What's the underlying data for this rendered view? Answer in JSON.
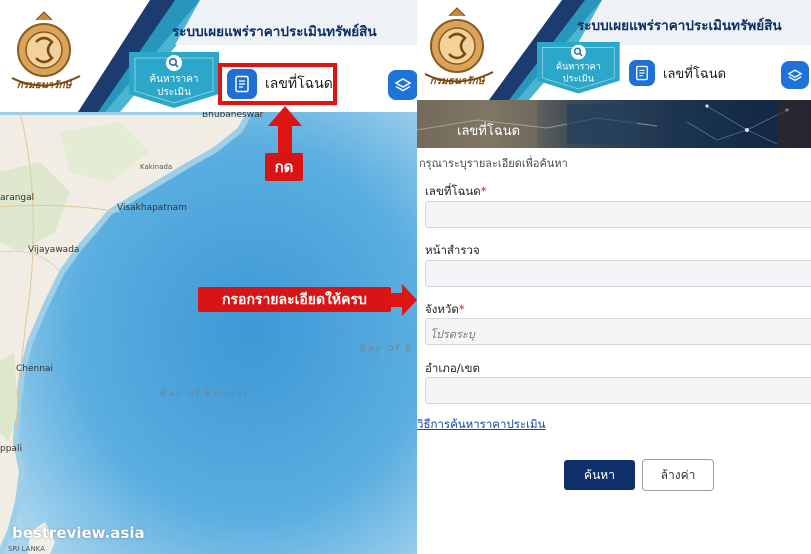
{
  "site": {
    "title": "ระบบเผยแพร่ราคาประเมินทรัพย์สิน",
    "logo_text": "กรมธนารักษ์"
  },
  "nav": {
    "search_price_label_line1": "ค้นหาราคา",
    "search_price_label_line2": "ประเมิน",
    "deed_tab_label": "เลขที่โฉนด"
  },
  "annotations": {
    "press_label": "กด",
    "fill_label": "กรอกรายละเอียดให้ครบ"
  },
  "map": {
    "places": {
      "bhubaneswar": "Bhubaneswar",
      "kakinada": "Kakinada",
      "warangal": "arangal",
      "visakhapatnam": "Visakhapatnam",
      "vijayawada": "Vijayawada",
      "chennai": "Chennai",
      "puducherry": "ppali",
      "sri_lanka": "SRI LANKA",
      "bay_of_bengal": "Bay of Bengal",
      "bay_of_b": "Bay of B"
    }
  },
  "watermark": "bestreview.asia",
  "form": {
    "banner_title": "เลขที่โฉนด",
    "hint": "กรุณาระบุรายละเอียดเพื่อค้นหา",
    "deed_no_label": "เลขที่โฉนด",
    "survey_page_label": "หน้าสำรวจ",
    "province_label": "จังหวัด",
    "province_placeholder": "โปรดระบุ",
    "district_label": "อำเภอ/เขต",
    "required_mark": "*",
    "howto_link": "วิธีการค้นหาราคาประเมิน",
    "search_button": "ค้นหา",
    "clear_button": "ล้างค่า"
  },
  "colors": {
    "primary": "#10306b",
    "accent_blue": "#1e6fd6",
    "badge_teal": "#2aa7c9",
    "annotation_red": "#d91414"
  }
}
